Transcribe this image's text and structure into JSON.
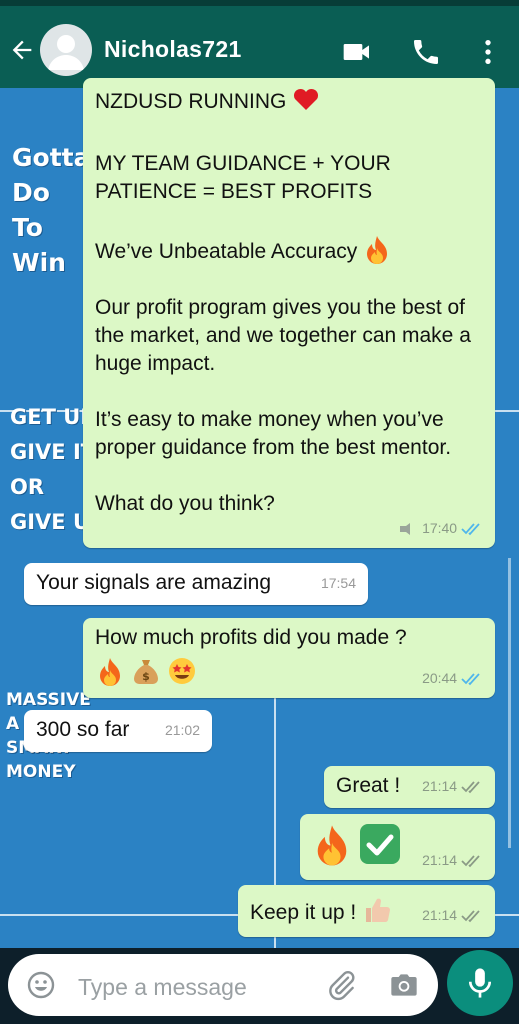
{
  "header": {
    "contact_name": "Nicholas721"
  },
  "wallpaper": {
    "text1": [
      "Gotta",
      "Do",
      "To",
      "Win"
    ],
    "text2": [
      "GET UP",
      "GIVE IT",
      "OR",
      "GIVE UP"
    ],
    "text3": [
      "MASSIVE",
      "A",
      "SMART",
      "MONEY"
    ]
  },
  "messages": [
    {
      "direction": "outgoing",
      "paragraphs": [
        "NZDUSD RUNNING",
        "MY TEAM GUIDANCE + YOUR PATIENCE = BEST PROFITS",
        "We’ve Unbeatable Accuracy",
        "Our profit program gives you the best of the market, and we together can make a huge impact.",
        "It’s easy to make money when you’ve proper guidance from the best mentor.",
        "What do you think?"
      ],
      "emoji": [
        "heart-emoji",
        "fire-emoji"
      ],
      "time": "17:40",
      "status": "read"
    },
    {
      "direction": "incoming",
      "text": "Your signals are amazing",
      "time": "17:54"
    },
    {
      "direction": "outgoing",
      "text": "How much profits did you made ?",
      "emoji": [
        "fire-emoji",
        "money-bag-emoji",
        "star-struck-emoji"
      ],
      "time": "20:44",
      "status": "read"
    },
    {
      "direction": "incoming",
      "text": "300 so far",
      "time": "21:02"
    },
    {
      "direction": "outgoing",
      "text": "Great !",
      "time": "21:14",
      "status": "delivered"
    },
    {
      "direction": "outgoing",
      "text": "",
      "emoji": [
        "fire-emoji",
        "check-mark-button-emoji"
      ],
      "time": "21:14",
      "status": "delivered"
    },
    {
      "direction": "outgoing",
      "text": "Keep it up !",
      "emoji": [
        "thumbs-up-emoji"
      ],
      "time": "21:14",
      "status": "delivered"
    }
  ],
  "input": {
    "placeholder": "Type a message"
  },
  "colors": {
    "header": "#0a5e54",
    "outgoing_bubble": "#dcf8c6",
    "incoming_bubble": "#ffffff",
    "read_tick": "#4fb6ec",
    "mic_button": "#0b8e7d",
    "wallpaper": "#2b82c4"
  }
}
